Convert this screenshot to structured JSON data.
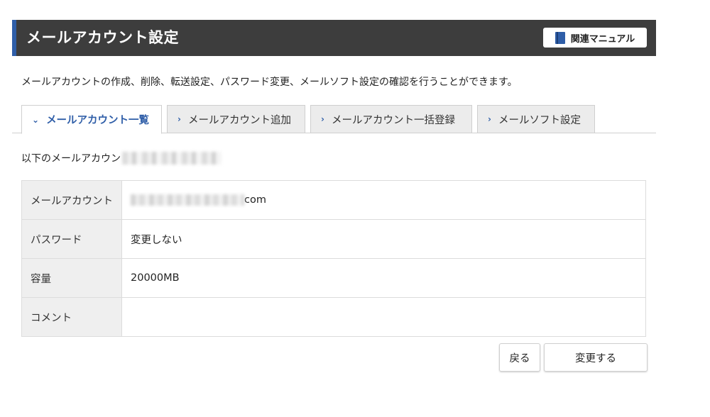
{
  "header": {
    "title": "メールアカウント設定",
    "manual_button": "関連マニュアル"
  },
  "description": "メールアカウントの作成、削除、転送設定、パスワード変更、メールソフト設定の確認を行うことができます。",
  "tabs": [
    {
      "label": "メールアカウント一覧",
      "active": true
    },
    {
      "label": "メールアカウント追加",
      "active": false
    },
    {
      "label": "メールアカウント一括登録",
      "active": false
    },
    {
      "label": "メールソフト設定",
      "active": false
    }
  ],
  "intro_text": "以下のメールアカウン",
  "form": {
    "rows": [
      {
        "label": "メールアカウント",
        "value": "com"
      },
      {
        "label": "パスワード",
        "value": "変更しない"
      },
      {
        "label": "容量",
        "value": "20000MB"
      },
      {
        "label": "コメント",
        "value": ""
      }
    ]
  },
  "buttons": {
    "back": "戻る",
    "submit": "変更する"
  },
  "colors": {
    "header_bg": "#3d3d3d",
    "accent": "#2f5ea8",
    "label_bg": "#efefef"
  }
}
